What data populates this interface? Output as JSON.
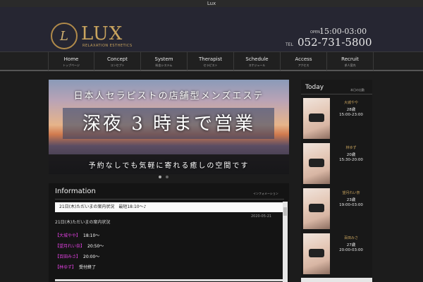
{
  "window": {
    "title": "Lux"
  },
  "header": {
    "logo_letter": "L",
    "logo_text": "LUX",
    "logo_sub": "RELAXATION ESTHETICS",
    "open_label": "OPEN",
    "open_time": "15:00-03:00",
    "tel_label": "TEL",
    "tel_number": "052-731-5800",
    "brand_color": "#c9a45e"
  },
  "nav": {
    "items": [
      {
        "label": "Home",
        "sub": "トップページ"
      },
      {
        "label": "Concept",
        "sub": "コンセプト"
      },
      {
        "label": "System",
        "sub": "料金システム"
      },
      {
        "label": "Therapist",
        "sub": "セラピスト"
      },
      {
        "label": "Schedule",
        "sub": "スケジュール"
      },
      {
        "label": "Access",
        "sub": "アクセス"
      },
      {
        "label": "Recruit",
        "sub": "求人案内"
      }
    ]
  },
  "banner": {
    "line1": "日本人セラピストの店舗型メンズエステ",
    "line2": "深夜 3 時まで営業",
    "line3": "予約なしでも気軽に寄れる癒しの空間です"
  },
  "information": {
    "title": "Information",
    "title_jp": "インフォメーション",
    "notice": "21日(木)ただいまの案内状況　最短18:10～♪",
    "date": "2020-05-21",
    "body_heading": "21日(木)ただいまの案内状況",
    "lines": [
      {
        "name": "【大城やや】",
        "status": "18:10～"
      },
      {
        "name": "【望月れい奈】",
        "status": "20:50～"
      },
      {
        "name": "【百田みさ】",
        "status": "20:00～"
      },
      {
        "name": "【林ゆず】",
        "status": "受付終了"
      }
    ]
  },
  "today": {
    "title": "Today",
    "title_jp": "本日の出勤",
    "therapists": [
      {
        "name": "大城やや",
        "age": "28歳",
        "time": "15:00-23:00"
      },
      {
        "name": "林ゆず",
        "age": "20歳",
        "time": "15:30-20:00"
      },
      {
        "name": "望月れい奈",
        "age": "23歳",
        "time": "19:00-03:00"
      },
      {
        "name": "百田みさ",
        "age": "27歳",
        "time": "20:00-03:00"
      }
    ]
  }
}
